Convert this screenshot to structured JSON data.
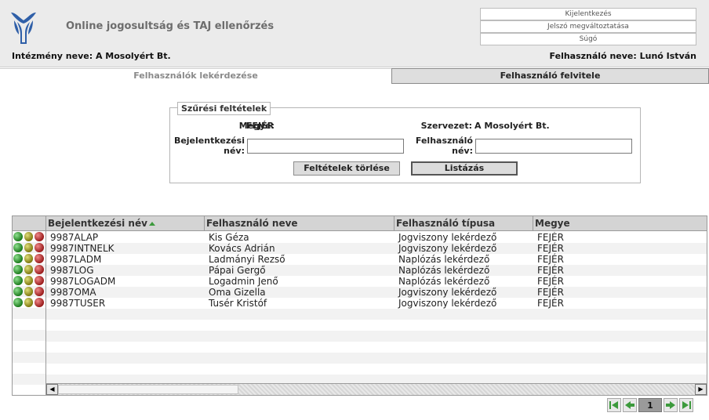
{
  "header": {
    "title": "Online jogosultság és TAJ ellenőrzés",
    "institution": "Intézmény neve: A Mosolyért Bt.",
    "user": "Felhasználó neve: Lunó István",
    "links": {
      "logout": "Kijelentkezés",
      "change_password": "Jelszó megváltoztatása",
      "help": "Súgó"
    }
  },
  "tabs": {
    "query": "Felhasználók lekérdezése",
    "create": "Felhasználó felvitele"
  },
  "filter": {
    "legend": "Szűrési feltételek",
    "county_label": "Megye:",
    "county_value": "FEJÉR",
    "org_label": "Szervezet:",
    "org_value": "A Mosolyért Bt.",
    "login_label_1": "Bejelentkezési",
    "login_label_2": "név:",
    "login_value": "",
    "username_label_1": "Felhasználó",
    "username_label_2": "név:",
    "username_value": "",
    "clear_button": "Feltételek törlése",
    "list_button": "Listázás"
  },
  "grid": {
    "columns": {
      "login": "Bejelentkezési név",
      "name": "Felhasználó neve",
      "type": "Felhasználó típusa",
      "county": "Megye"
    },
    "rows": [
      {
        "login": "9987ALAP",
        "name": "Kis Géza",
        "type": "Jogviszony lekérdező",
        "county": "FEJÉR"
      },
      {
        "login": "9987INTNELK",
        "name": "Kovács Adrián",
        "type": "Jogviszony lekérdező",
        "county": "FEJÉR"
      },
      {
        "login": "9987LADM",
        "name": "Ladmányi Rezső",
        "type": "Naplózás lekérdező",
        "county": "FEJÉR"
      },
      {
        "login": "9987LOG",
        "name": "Pápai Gergő",
        "type": "Naplózás lekérdező",
        "county": "FEJÉR"
      },
      {
        "login": "9987LOGADM",
        "name": "Logadmin Jenő",
        "type": "Naplózás lekérdező",
        "county": "FEJÉR"
      },
      {
        "login": "9987OMA",
        "name": "Oma Gizella",
        "type": "Jogviszony lekérdező",
        "county": "FEJÉR"
      },
      {
        "login": "9987TUSER",
        "name": "Tusér Kristóf",
        "type": "Jogviszony lekérdező",
        "county": "FEJÉR"
      }
    ],
    "row_icons": [
      "green-ball-icon",
      "olive-ball-icon",
      "red-ball-icon"
    ]
  },
  "pager": {
    "page": "1"
  },
  "colors": {
    "header_bg": "#ebebeb",
    "title_gray": "#6d6d6d",
    "logo_blue": "#2f5fa8",
    "grid_header": "#d4d4d4",
    "pager_green": "#3c9a3c"
  }
}
